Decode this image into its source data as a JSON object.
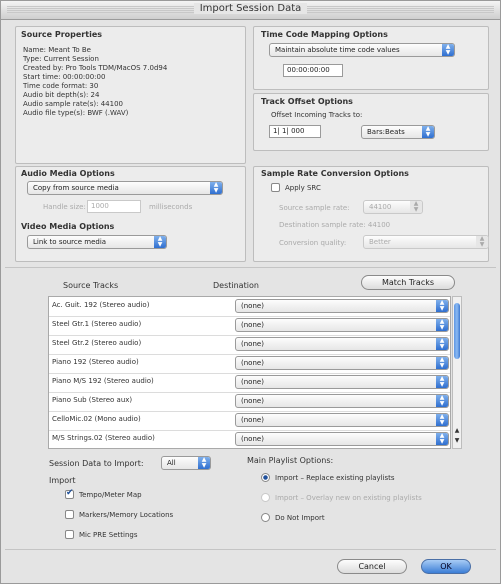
{
  "window": {
    "title": "Import Session Data"
  },
  "source_properties": {
    "heading": "Source Properties",
    "lines": [
      "Name: Meant To Be",
      "Type: Current Session",
      "Created by: Pro Tools TDM/MacOS 7.0d94",
      "Start time: 00:00:00:00",
      "Time code format: 30",
      "Audio bit depth(s): 24",
      "Audio sample rate(s): 44100",
      "Audio file type(s): BWF (.WAV)"
    ]
  },
  "time_code_mapping": {
    "heading": "Time Code Mapping Options",
    "selected": "Maintain absolute time code values",
    "timecode_value": "00:00:00:00"
  },
  "track_offset": {
    "heading": "Track Offset Options",
    "label": "Offset Incoming Tracks to:",
    "value": "1| 1| 000",
    "unit": "Bars:Beats"
  },
  "audio_media": {
    "heading": "Audio Media Options",
    "selected": "Copy from source media",
    "handle_label": "Handle size:",
    "handle_value": "1000",
    "handle_unit": "milliseconds"
  },
  "video_media": {
    "heading": "Video Media Options",
    "selected": "Link to source media"
  },
  "sample_rate": {
    "heading": "Sample Rate Conversion Options",
    "apply_label": "Apply SRC",
    "source_label": "Source sample rate:",
    "source_value": "44100",
    "dest_label": "Destination sample rate: 44100",
    "quality_label": "Conversion quality:",
    "quality_value": "Better"
  },
  "tracks": {
    "col_source": "Source Tracks",
    "col_dest": "Destination",
    "match_button": "Match Tracks",
    "rows": [
      {
        "name": "Ac. Guit. 192 (Stereo audio)",
        "dest": "(none)"
      },
      {
        "name": "Steel Gtr.1 (Stereo audio)",
        "dest": "(none)"
      },
      {
        "name": "Steel Gtr.2 (Stereo audio)",
        "dest": "(none)"
      },
      {
        "name": "Piano 192 (Stereo audio)",
        "dest": "(none)"
      },
      {
        "name": "Piano M/S 192 (Stereo audio)",
        "dest": "(none)"
      },
      {
        "name": "Piano Sub (Stereo aux)",
        "dest": "(none)"
      },
      {
        "name": "CelloMic.02 (Mono audio)",
        "dest": "(none)"
      },
      {
        "name": "M/S Strings.02 (Stereo audio)",
        "dest": "(none)"
      }
    ]
  },
  "session_data": {
    "label": "Session Data to Import:",
    "selected": "All",
    "import_heading": "Import",
    "options": [
      {
        "label": "Tempo/Meter Map",
        "checked": true
      },
      {
        "label": "Markers/Memory Locations",
        "checked": false
      },
      {
        "label": "Mic PRE Settings",
        "checked": false
      }
    ]
  },
  "playlist": {
    "heading": "Main Playlist Options:",
    "options": [
      {
        "label": "Import – Replace existing playlists",
        "selected": true,
        "enabled": true
      },
      {
        "label": "Import – Overlay new on existing playlists",
        "selected": false,
        "enabled": false
      },
      {
        "label": "Do Not Import",
        "selected": false,
        "enabled": true
      }
    ]
  },
  "buttons": {
    "cancel": "Cancel",
    "ok": "OK"
  },
  "colors": {
    "accent": "#3c7ed6",
    "window": "#e4e4e4"
  },
  "icons": {
    "popup": "up-down-arrows-icon",
    "check": "checkmark-icon"
  }
}
